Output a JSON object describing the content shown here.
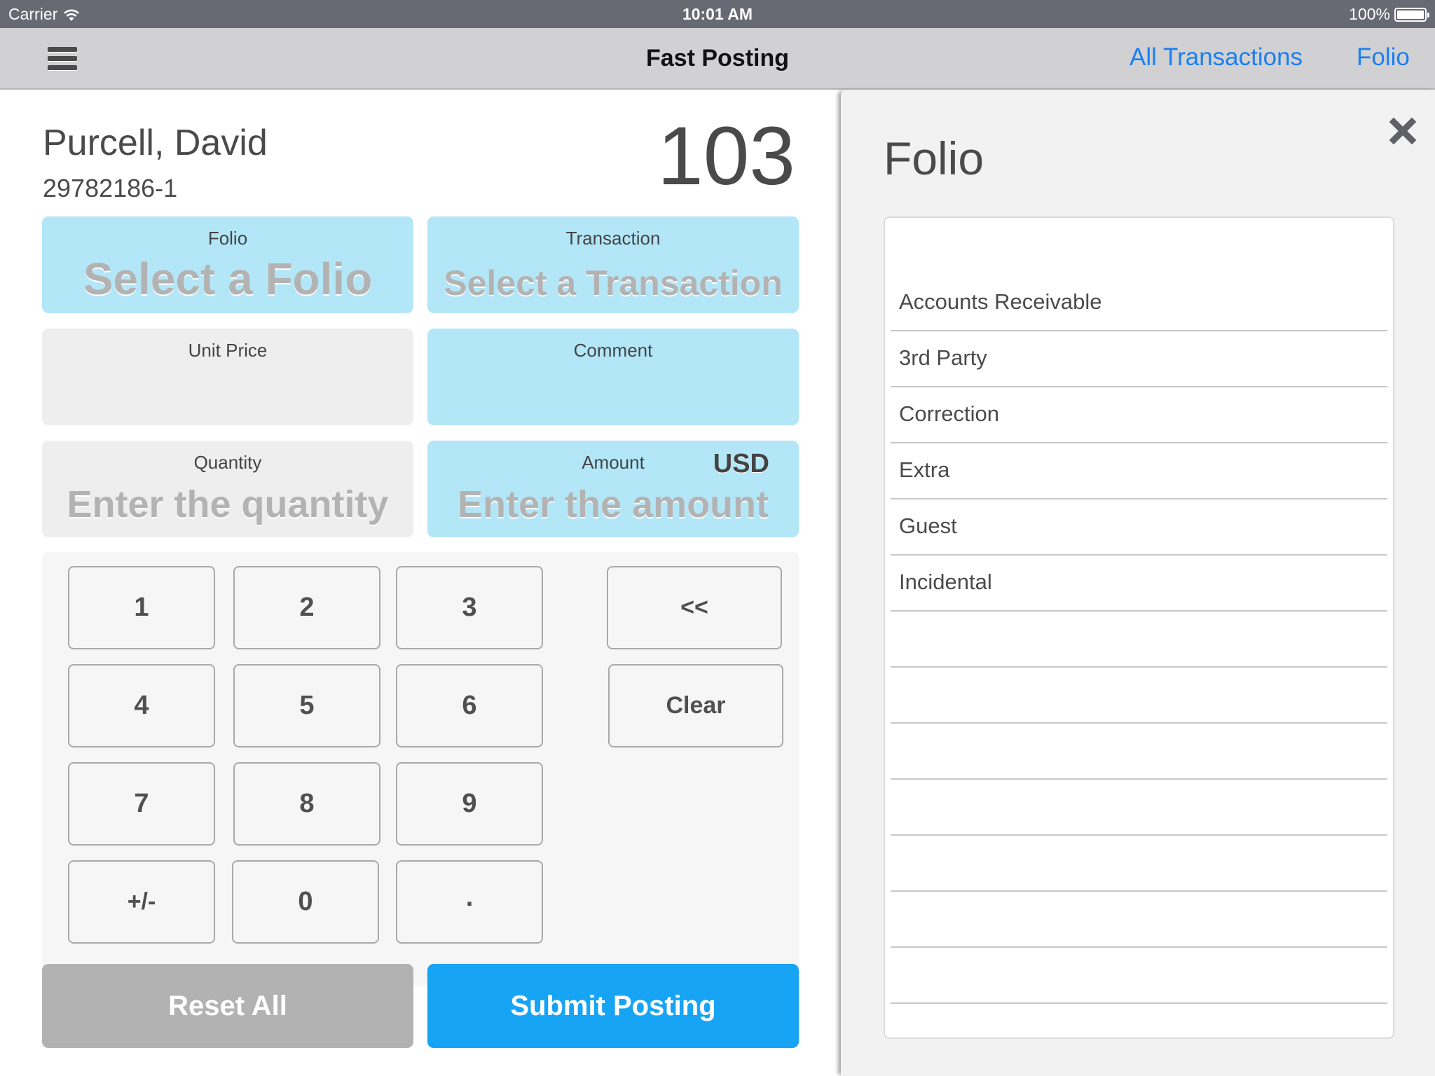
{
  "status_bar": {
    "carrier": "Carrier",
    "time": "10:01 AM",
    "battery": "100%",
    "battery_level": 1.0,
    "wifi_icon": "wifi-icon",
    "battery_icon": "battery-icon"
  },
  "nav": {
    "menu_icon": "hamburger-menu-icon",
    "title": "Fast Posting",
    "links": [
      "All Transactions",
      "Folio"
    ],
    "link_color": "#1a7ff0"
  },
  "guest": {
    "name": "Purcell, David",
    "id": "29782186-1",
    "room": "103"
  },
  "fields": {
    "folio": {
      "label": "Folio",
      "placeholder": "Select a Folio"
    },
    "transaction": {
      "label": "Transaction",
      "placeholder": "Select a Transaction"
    },
    "unit_price": {
      "label": "Unit Price",
      "value": ""
    },
    "comment": {
      "label": "Comment",
      "value": ""
    },
    "quantity": {
      "label": "Quantity",
      "placeholder": "Enter the quantity"
    },
    "amount": {
      "label": "Amount",
      "placeholder": "Enter the amount",
      "currency": "USD"
    }
  },
  "keypad": {
    "keys": [
      "1",
      "2",
      "3",
      "4",
      "5",
      "6",
      "7",
      "8",
      "9",
      "+/-",
      "0",
      "."
    ],
    "backspace": "<<",
    "clear": "Clear"
  },
  "actions": {
    "reset": "Reset All",
    "submit": "Submit Posting"
  },
  "folio_panel": {
    "title": "Folio",
    "close_icon": "close-icon",
    "items": [
      "Accounts Receivable",
      "3rd Party",
      "Correction",
      "Extra",
      "Guest",
      "Incidental",
      "",
      "",
      "",
      "",
      "",
      "",
      ""
    ]
  },
  "colors": {
    "status_bar": "#686a73",
    "nav_bar": "#d1d1d4",
    "field_active": "#b3e7f8",
    "field_inactive": "#eeeeee",
    "submit": "#17a4f5",
    "reset": "#b2b2b2"
  }
}
